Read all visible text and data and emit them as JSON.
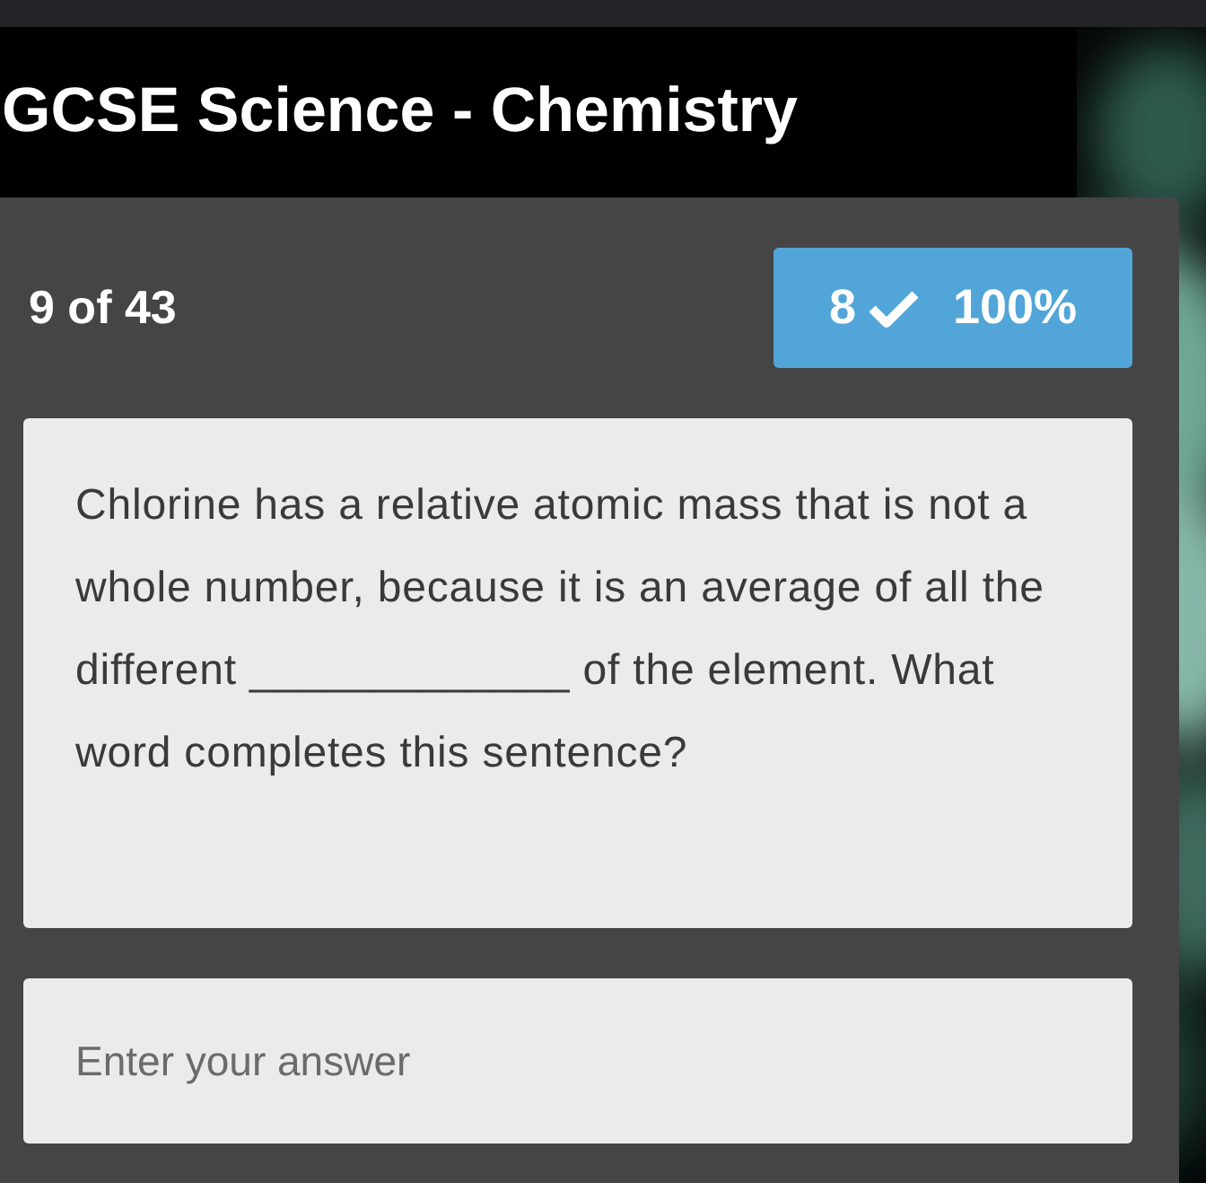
{
  "header": {
    "title": "GCSE Science - Chemistry"
  },
  "progress": {
    "position": "9 of 43",
    "correct": "8",
    "score": "100%"
  },
  "question": {
    "text": "Chlorine has a relative atomic mass that is not a whole number, because it is an average of all the different _____________ of the element. What word completes this sentence?"
  },
  "answer": {
    "placeholder": "Enter your answer"
  }
}
